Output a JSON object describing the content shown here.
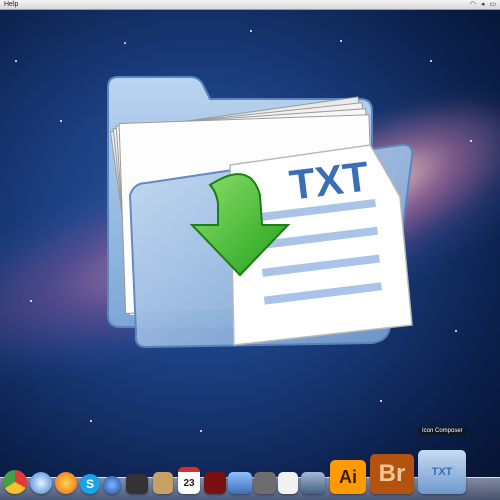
{
  "menubar": {
    "app_menu": "Help",
    "icons": [
      "wifi-icon",
      "volume-icon",
      "battery-icon"
    ]
  },
  "main_icon": {
    "label": "TXT",
    "icon": "txt-folder-download-icon"
  },
  "dock": {
    "tooltip": "Icon Composer",
    "ai_label": "Ai",
    "br_label": "Br",
    "calendar_day": "23",
    "txt_label": "TXT",
    "items": [
      "chrome-icon",
      "safari-icon",
      "firefox-icon",
      "skype-icon",
      "quicktime-icon",
      "camera-icon",
      "book-icon",
      "calendar-icon",
      "photo-booth-icon",
      "iphoto-icon",
      "preview-icon",
      "paper-icon",
      "image-capture-icon",
      "illustrator-icon",
      "bridge-icon",
      "icon-composer-icon"
    ]
  },
  "colors": {
    "illustrator": "#ff9a00",
    "bridge": "#b3530f",
    "folder": "#9fc1e6",
    "arrow": "#3cbf2e",
    "txt_text": "#3a6fb5"
  }
}
